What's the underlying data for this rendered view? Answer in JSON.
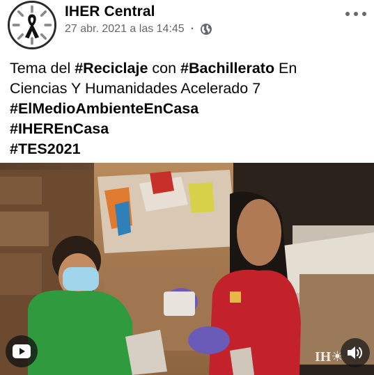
{
  "post": {
    "page_name": "IHER Central",
    "timestamp": "27 abr. 2021 a las 14:45",
    "separator": "·",
    "privacy_icon": "globe-icon",
    "menu_icon": "more-horizontal-icon"
  },
  "text": {
    "line1_a": "Tema del ",
    "line1_tag1": "#Reciclaje",
    "line1_b": " con ",
    "line1_tag2": "#Bachillerato",
    "line1_c": " En",
    "line2": "Ciencias Y Humanidades Acelerado 7",
    "tag3": "#ElMedioAmbienteEnCasa",
    "tag4": "#IHEREnCasa",
    "tag5": "#TES2021"
  },
  "video": {
    "watermark": "IH☀",
    "controls": {
      "play_icon": "youtube-play-icon",
      "sound_icon": "speaker-icon"
    }
  }
}
